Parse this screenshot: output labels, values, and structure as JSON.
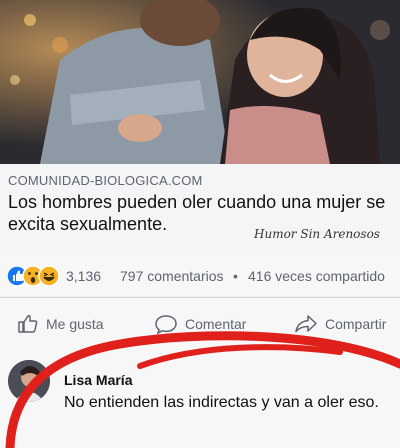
{
  "post": {
    "source": "COMUNIDAD-BIOLOGICA.COM",
    "headline": "Los hombres pueden oler cuando una mujer se excita sexualmente.",
    "watermark": "Humor Sin Arenosos"
  },
  "stats": {
    "reactions": "3,136",
    "comments": "797 comentarios",
    "separator": "•",
    "shares": "416 veces compartido"
  },
  "actions": {
    "like": "Me gusta",
    "comment": "Comentar",
    "share": "Compartir"
  },
  "comment": {
    "author": "Lisa María",
    "text": "No entienden las indirectas y van a oler eso."
  },
  "colors": {
    "like_blue": "#1877f2",
    "haha_yellow": "#f7b125",
    "annotation_red": "#e0211b"
  },
  "icons": [
    "like-reaction-icon",
    "wow-reaction-icon",
    "haha-reaction-icon",
    "thumbs-up-icon",
    "comment-icon",
    "share-icon"
  ]
}
